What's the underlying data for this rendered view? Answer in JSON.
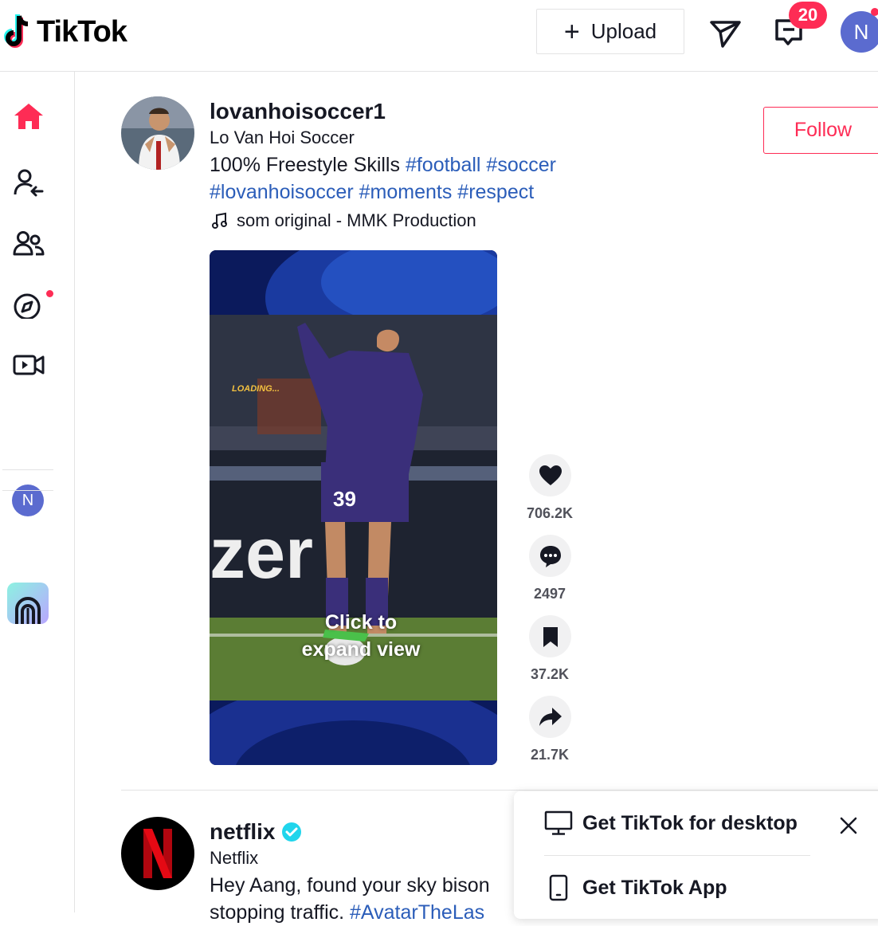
{
  "header": {
    "logo_text": "TikTok",
    "upload_label": "Upload",
    "inbox_badge": "20",
    "avatar_initial": "N"
  },
  "sidebar": {
    "items": [
      {
        "name": "home",
        "icon": "home-icon"
      },
      {
        "name": "following",
        "icon": "following-icon"
      },
      {
        "name": "friends",
        "icon": "friends-icon"
      },
      {
        "name": "explore",
        "icon": "compass-icon"
      },
      {
        "name": "live",
        "icon": "live-video-icon"
      },
      {
        "name": "profile",
        "initial": "N"
      }
    ]
  },
  "post": {
    "username": "lovanhoisoccer1",
    "nickname": "Lo Van Hoi Soccer",
    "desc_text": "100% Freestyle Skills ",
    "hashtags": [
      "#football",
      "#soccer",
      "#lovanhoisoccer",
      "#moments",
      "#respect"
    ],
    "music": "som original - MMK Production",
    "follow_label": "Follow",
    "video_overlay_text": "Click to expand view",
    "video_loading_text": "LOADING...",
    "player_number": "39",
    "likes": "706.2K",
    "comments": "2497",
    "saves": "37.2K",
    "shares": "21.7K"
  },
  "post2": {
    "username": "netflix",
    "nickname": "Netflix",
    "desc_line1": "Hey Aang, found your sky bison",
    "desc_line2_text": "stopping traffic. ",
    "desc_line2_tag": "#AvatarTheLas"
  },
  "popup": {
    "desktop_label": "Get TikTok for desktop",
    "app_label": "Get TikTok App"
  },
  "colors": {
    "accent": "#fe2c55",
    "hashtag": "#2b5db9",
    "avatar_bg": "#5b6bcf"
  }
}
